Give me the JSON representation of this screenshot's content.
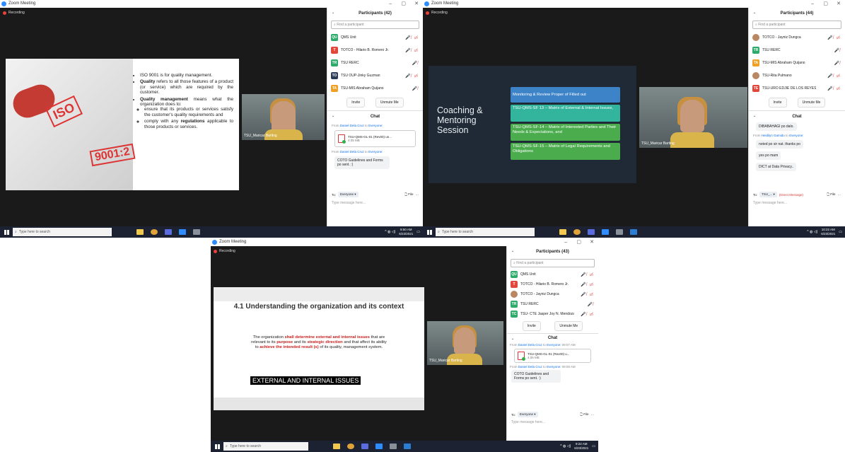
{
  "app_title": "Zoom Meeting",
  "recording_label": "Recording",
  "window_controls": [
    "–",
    "▢",
    "✕"
  ],
  "colors": {
    "zoom_blue": "#2d8cff",
    "muted_red": "#d9403a",
    "avatar_green": "#2eaa6a",
    "avatar_red": "#e1473a",
    "avatar_orange": "#f0a025",
    "avatar_navy": "#2b3a55",
    "slide_blue": "#3c83c7",
    "slide_teal": "#33b49c",
    "slide_green": "#4bac4e"
  },
  "taskbar": {
    "search_placeholder": "Type here to search",
    "clock1_time": "9:50 AM",
    "clock1_date": "6/23/2021",
    "clock2_time": "10:22 AM",
    "clock2_date": "6/23/2021",
    "clock3_time": "9:22 AM",
    "clock3_date": "6/23/2021"
  },
  "shot1": {
    "participants_title": "Participants (42)",
    "find_placeholder": "Find a participant",
    "participants": [
      {
        "initials": "QU",
        "name": "QMS Unit",
        "color": "#2eaa6a",
        "icons": "🎤̸ ▭̸"
      },
      {
        "initials": "T",
        "name": "TOTCO - Hilario B. Romero Jr.",
        "color": "#e1473a",
        "icons": "🎤̸ ▭̸"
      },
      {
        "initials": "TR",
        "name": "TSU RERC",
        "color": "#2eaa6a",
        "icons": "🎤̸"
      },
      {
        "initials": "TO",
        "name": "TSU OUP-Jinky Guzman",
        "color": "#2b3a55",
        "icons": "🎤̸ ▭̸"
      },
      {
        "initials": "TA",
        "name": "TSU-MIS Abraham Quijano",
        "color": "#f0a025",
        "icons": "🎤̸"
      }
    ],
    "invite_label": "Invite",
    "unmute_label": "Unmute Me",
    "chat_title": "Chat",
    "msg1_from_prefix": "From",
    "msg1_sender": "Daniel Dela Cruz",
    "msg1_to_word": "to",
    "msg1_recipient": "Everyone:",
    "file_name": "TSU-QMS-GL-01 (Rev00) un...",
    "file_size": "4.05 MB",
    "msg2_from_prefix": "From",
    "msg2_sender": "Daniel Dela Cruz",
    "msg2_to_word": "to",
    "msg2_recipient": "Everyone:",
    "msg2_text": "COTO Guidelines and Forms po sent. :)",
    "to_label": "To:",
    "to_value": "Everyone ▾",
    "file_btn": "File",
    "more_btn": "···",
    "type_placeholder": "Type message here...",
    "slide": {
      "b1_pre": "ISO 9001 is for quality management.",
      "b2_bold": "Quality",
      "b2_rest": " refers to all those features of a product (or service) which are required by the customer.",
      "b3_bold": "Quality management",
      "b3_rest": " means what the organization does to:",
      "sub1": "ensure that its products or services satisfy the customer's quality requirements and",
      "sub2_pre": "comply with any ",
      "sub2_bold": "regulations",
      "sub2_rest": " applicable to those products or services.",
      "stamp_text_1": "ISO",
      "stamp_text_2": "9001:2"
    },
    "cam_name": "TSU_Maricar Barting"
  },
  "shot2": {
    "participants_title": "Participants (44)",
    "find_placeholder": "Find a participant",
    "participants": [
      {
        "initials": "",
        "name": "TOTCO - Jayniz Dungca",
        "color": "#b98762",
        "photo": true,
        "icons": "🎤̸ ▭̸"
      },
      {
        "initials": "TR",
        "name": "TSU RERC",
        "color": "#2eaa6a",
        "icons": "🎤̸"
      },
      {
        "initials": "TA",
        "name": "TSU-MIS Abraham Quijano",
        "color": "#f0a025",
        "icons": "🎤̸"
      },
      {
        "initials": "",
        "name": "TSU-Rita Pulmano",
        "color": "#b98762",
        "photo": true,
        "icons": "🎤̸ ▭̸"
      },
      {
        "initials": "TE",
        "name": "TSU-URO EDJIE DE LOS REYES",
        "color": "#e1473a",
        "icons": "🎤̸ ▭̸"
      }
    ],
    "invite_label": "Invite",
    "unmute_label": "Unmute Me",
    "chat_title": "Chat",
    "msg0_text": "DIBABAHAGI po dalo.",
    "msg1_from_prefix": "From",
    "msg1_sender": "Heidilyn Gamido",
    "msg1_to_word": "to",
    "msg1_recipient": "Everyone:",
    "msg1_text": "noted po sir nat. thanks po",
    "msg2_text": "yes po mam",
    "msg3_text": "DICT at Data Privacy..",
    "to_label": "To:",
    "to_value": "TSU_... ▾",
    "direct_label": "(Direct Message)",
    "file_btn": "File",
    "more_btn": "···",
    "type_placeholder": "Type message here...",
    "slide": {
      "title": "Coaching & Mentoring Session",
      "box1": "Monitoring & Review Proper of Filled out",
      "box2": "TSU-QMS-SF 13 – Matrix of External & Internal Issues,",
      "box3": "TSU-QMS-SF-14 – Matrix of Interested Parties and Their Needs & Expectations, and",
      "box4": "TSU-QMS-SF-15 – Matrix of Legal Requirements and Obligations"
    },
    "cam_name": "TSU_Maricar Barting"
  },
  "shot3": {
    "participants_title": "Participants (43)",
    "find_placeholder": "Find a participant",
    "participants": [
      {
        "initials": "QU",
        "name": "QMS Unit",
        "color": "#2eaa6a",
        "icons": "🎤̸ ▭̸"
      },
      {
        "initials": "T",
        "name": "TOTCO - Hilario B. Romero Jr.",
        "color": "#e1473a",
        "icons": "🎤̸ ▭̸"
      },
      {
        "initials": "",
        "name": "TOTCO - Jayniz Dungca",
        "color": "#b98762",
        "photo": true,
        "icons": "🎤̸ ▭̸"
      },
      {
        "initials": "TR",
        "name": "TSU RERC",
        "color": "#2eaa6a",
        "icons": "🎤̸"
      },
      {
        "initials": "TC",
        "name": "TSU- CTE Jasper Joy N. Mendoza",
        "color": "#2eaa6a",
        "icons": "🎤̸ ▭̸"
      }
    ],
    "invite_label": "Invite",
    "unmute_label": "Unmute Me",
    "chat_title": "Chat",
    "msg1_from_prefix": "From",
    "msg1_sender": "Daniel Dela Cruz",
    "msg1_to_word": "to",
    "msg1_recipient": "Everyone:",
    "msg1_time": "09:07 AM",
    "file_name": "TSU-QMS-GL-01 (Rev00) u...",
    "file_size": "4.05 MB",
    "msg2_from_prefix": "From",
    "msg2_sender": "Daniel Dela Cruz",
    "msg2_to_word": "to",
    "msg2_recipient": "Everyone:",
    "msg2_time": "09:08 AM",
    "msg2_text": "COTO Guidelines and Forms po sent. :)",
    "to_label": "To:",
    "to_value": "Everyone ▾",
    "file_btn": "File",
    "more_btn": "···",
    "type_placeholder": "Type message here...",
    "slide": {
      "heading": "4.1 Understanding the organization and its context",
      "p1": "The organization ",
      "r1": "shall determine external and internal issues",
      "p2": " that are relevant to its ",
      "r2": "purpose",
      "p3": " and its ",
      "r3": "strategic direction",
      "p4": " and that affect its ability to ",
      "r4": "achieve the intended result (s)",
      "p5": " of its quality, management system.",
      "banner": "EXTERNAL AND INTERNAL ISSUES"
    },
    "cam_name": "TSU_Maricar Barting"
  }
}
